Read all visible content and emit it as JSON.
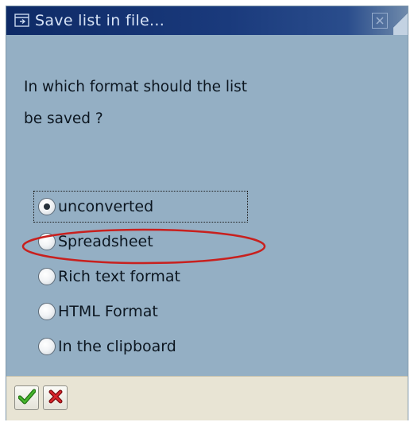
{
  "window": {
    "title": "Save list in file...",
    "title_icon": "dialog-window-icon",
    "close_icon": "close-icon"
  },
  "question": {
    "line1": "In which format should the list",
    "line2": "be saved ?"
  },
  "format_options": [
    {
      "label": "unconverted",
      "checked": true,
      "focused": true
    },
    {
      "label": "Spreadsheet",
      "checked": false,
      "highlighted": true
    },
    {
      "label": "Rich text format",
      "checked": false
    },
    {
      "label": "HTML Format",
      "checked": false
    },
    {
      "label": "In the clipboard",
      "checked": false
    }
  ],
  "footer": {
    "confirm_icon": "checkmark-icon",
    "cancel_icon": "cancel-x-icon"
  },
  "colors": {
    "dialog_background": "#94afc4",
    "titlebar": "#0e2a66",
    "highlight_ellipse": "#c8201e",
    "confirm_green": "#2e9a1d",
    "cancel_red": "#c3141b"
  }
}
